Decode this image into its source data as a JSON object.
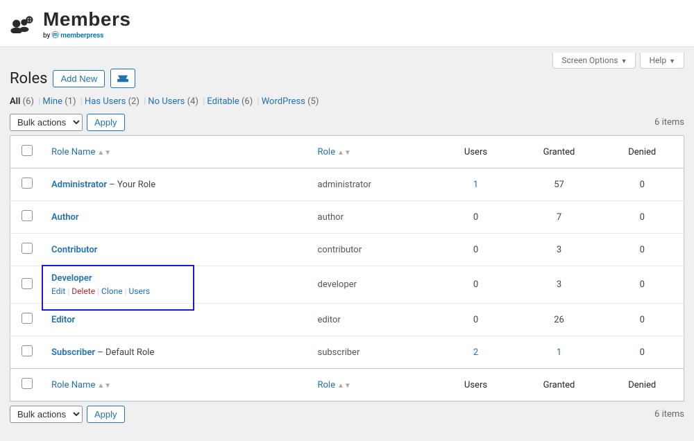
{
  "brand": {
    "title": "Members",
    "by": "by",
    "mp": "memberpress"
  },
  "screen_meta": {
    "options": "Screen Options",
    "help": "Help"
  },
  "page": {
    "heading": "Roles",
    "add_new": "Add New"
  },
  "filters": [
    {
      "label": "All",
      "count": "(6)",
      "current": true
    },
    {
      "label": "Mine",
      "count": "(1)"
    },
    {
      "label": "Has Users",
      "count": "(2)"
    },
    {
      "label": "No Users",
      "count": "(4)"
    },
    {
      "label": "Editable",
      "count": "(6)"
    },
    {
      "label": "WordPress",
      "count": "(5)"
    }
  ],
  "bulk": {
    "label": "Bulk actions",
    "apply": "Apply"
  },
  "items_text": "6 items",
  "columns": {
    "name": "Role Name",
    "role": "Role",
    "users": "Users",
    "granted": "Granted",
    "denied": "Denied"
  },
  "rows": [
    {
      "name": "Administrator",
      "badge": " – Your Role",
      "slug": "administrator",
      "users": "1",
      "users_link": true,
      "granted": "57",
      "denied": "0"
    },
    {
      "name": "Author",
      "slug": "author",
      "users": "0",
      "granted": "7",
      "denied": "0"
    },
    {
      "name": "Contributor",
      "slug": "contributor",
      "users": "0",
      "granted": "3",
      "denied": "0"
    },
    {
      "name": "Developer",
      "slug": "developer",
      "users": "0",
      "granted": "3",
      "denied": "0",
      "highlight": true,
      "actions": {
        "edit": "Edit",
        "delete": "Delete",
        "clone": "Clone",
        "users": "Users"
      }
    },
    {
      "name": "Editor",
      "slug": "editor",
      "users": "0",
      "granted": "26",
      "denied": "0"
    },
    {
      "name": "Subscriber",
      "badge": " – Default Role",
      "slug": "subscriber",
      "users": "2",
      "users_link": true,
      "granted": "1",
      "granted_link": true,
      "denied": "0"
    }
  ]
}
